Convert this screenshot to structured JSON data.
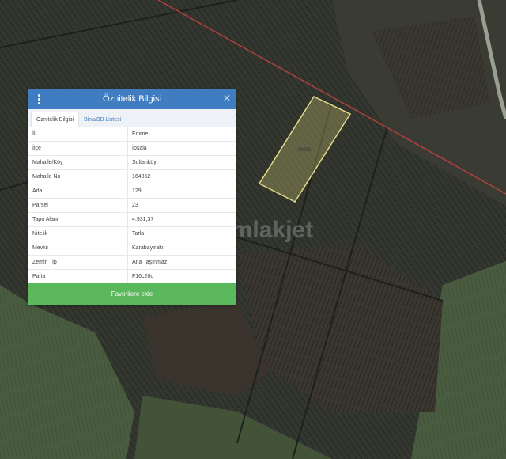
{
  "map": {
    "parcel_label": "00000",
    "watermark_text": "emlakjet",
    "colors": {
      "ground_dark": "#2b2f27",
      "field_green": "#46573e",
      "parcel_outline": "#e6d98a",
      "boundary_line": "#b24040"
    }
  },
  "panel": {
    "title": "Öznitelik Bilgisi",
    "menu_icon": "vertical-dots-icon",
    "close_icon": "close-icon",
    "tabs": [
      {
        "label": "Öznitelik Bilgisi",
        "active": true
      },
      {
        "label": "Bina/BB Listesi",
        "active": false
      }
    ],
    "rows": [
      {
        "key": "İl",
        "value": "Edirne"
      },
      {
        "key": "İlçe",
        "value": "İpsala"
      },
      {
        "key": "Mahalle/Köy",
        "value": "Sultanköy"
      },
      {
        "key": "Mahalle No",
        "value": "164352"
      },
      {
        "key": "Ada",
        "value": "129"
      },
      {
        "key": "Parsel",
        "value": "23"
      },
      {
        "key": "Tapu Alanı",
        "value": "4.931,37"
      },
      {
        "key": "Nitelik",
        "value": "Tarla"
      },
      {
        "key": "Mevkii",
        "value": "Karabayıraltı"
      },
      {
        "key": "Zemin Tip",
        "value": "Ana Taşınmaz"
      },
      {
        "key": "Pafta",
        "value": "F16c20c"
      }
    ],
    "favorite_button": "Favorilere ekle",
    "colors": {
      "header": "#3f7cc1",
      "button": "#5cb85c"
    }
  }
}
